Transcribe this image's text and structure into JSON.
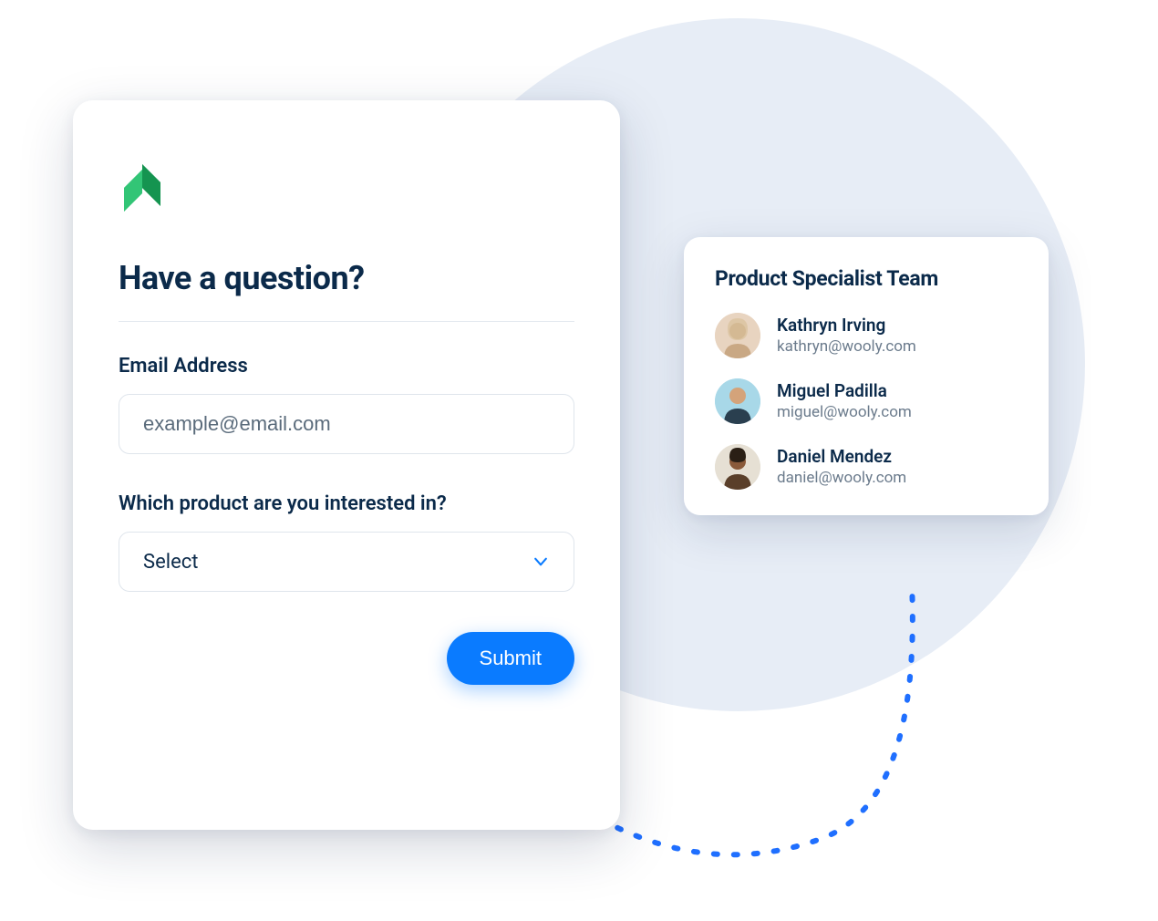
{
  "form": {
    "title": "Have a question?",
    "email_label": "Email Address",
    "email_placeholder": "example@email.com",
    "product_label": "Which product are you interested in?",
    "product_select_placeholder": "Select",
    "submit_label": "Submit"
  },
  "team": {
    "title": "Product Specialist Team",
    "members": [
      {
        "name": "Kathryn Irving",
        "email": "kathryn@wooly.com"
      },
      {
        "name": "Miguel Padilla",
        "email": "miguel@wooly.com"
      },
      {
        "name": "Daniel Mendez",
        "email": "daniel@wooly.com"
      }
    ]
  },
  "colors": {
    "accent": "#0a7bff",
    "logo_green": "#2fbf71"
  }
}
